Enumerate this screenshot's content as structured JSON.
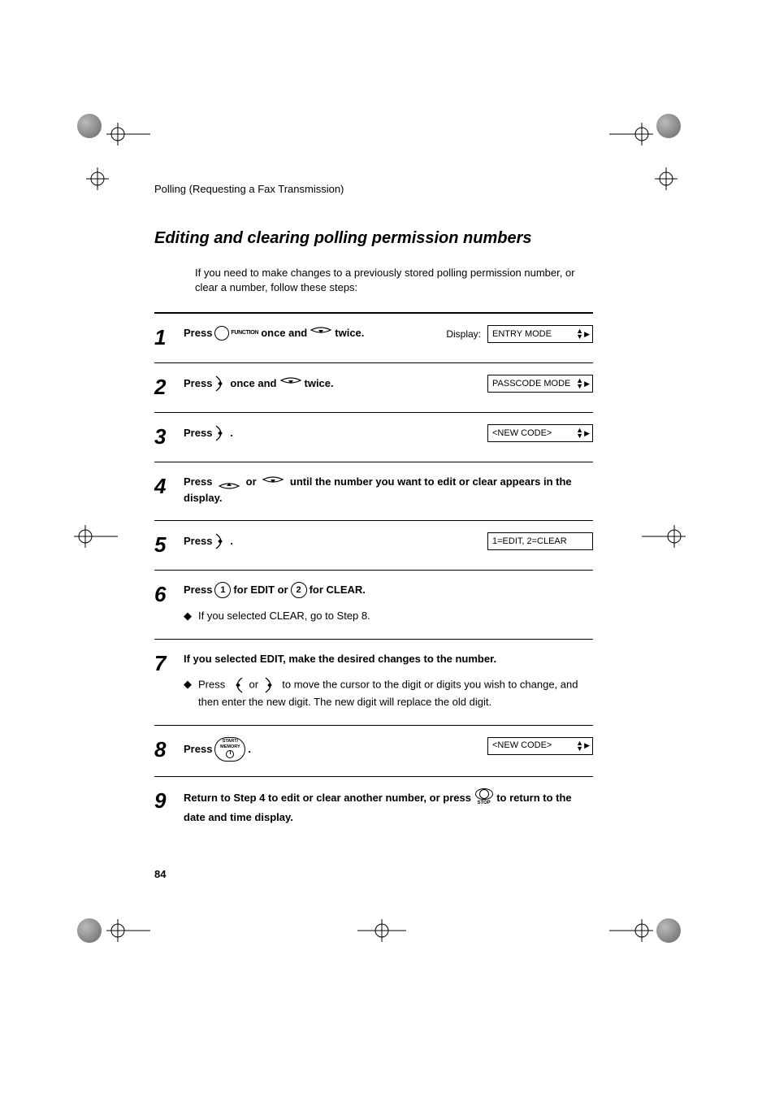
{
  "running_head": "Polling (Requesting a Fax Transmission)",
  "section_title": "Editing and clearing polling permission numbers",
  "intro": "If you need to make changes to a previously stored polling permission number, or clear a number, follow these steps:",
  "display_label": "Display:",
  "steps": {
    "s1": {
      "num": "1",
      "t1": "Press ",
      "func": "FUNCTION",
      "t2": " once and ",
      "t3": " twice.",
      "lcd": "ENTRY MODE"
    },
    "s2": {
      "num": "2",
      "t1": "Press ",
      "t2": " once and ",
      "t3": " twice.",
      "lcd": "PASSCODE MODE"
    },
    "s3": {
      "num": "3",
      "t1": "Press ",
      "t2": ".",
      "lcd": "<NEW CODE>"
    },
    "s4": {
      "num": "4",
      "t1": "Press ",
      "t2": " or ",
      "t3": " until the number you want to edit or clear appears in the display."
    },
    "s5": {
      "num": "5",
      "t1": "Press ",
      "t2": ".",
      "lcd": "1=EDIT, 2=CLEAR"
    },
    "s6": {
      "num": "6",
      "t1": "Press ",
      "d1": "1",
      "t2": " for EDIT or ",
      "d2": "2",
      "t3": " for CLEAR.",
      "bullet": "If you selected CLEAR, go to Step 8."
    },
    "s7": {
      "num": "7",
      "t1": "If you selected EDIT, make the desired changes to the number.",
      "b1a": "Press ",
      "b1b": " or ",
      "b1c": " to move the cursor to the digit or digits you wish to change, and then enter the new digit. The new digit will replace the old digit."
    },
    "s8": {
      "num": "8",
      "t1": "Press ",
      "sm1": "START/",
      "sm2": "MEMORY",
      "t2": ".",
      "lcd": "<NEW CODE>"
    },
    "s9": {
      "num": "9",
      "t1": "Return to Step 4 to edit or clear another number, or press ",
      "stop": "STOP",
      "t2": " to return to the date and time display."
    }
  },
  "page_number": "84"
}
